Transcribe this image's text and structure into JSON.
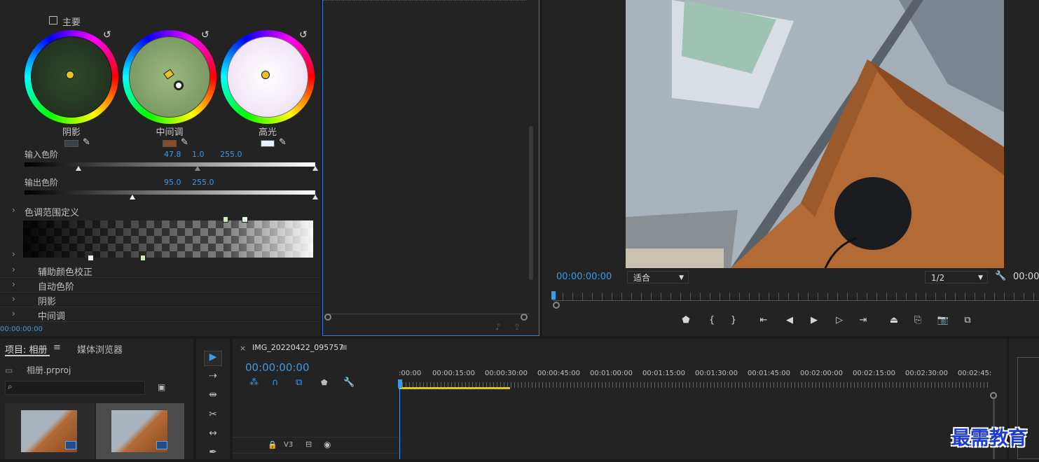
{
  "lumetri": {
    "master_checkbox_label": "主要",
    "wheels": [
      {
        "label": "阴影",
        "swatch_color": "#3b4147"
      },
      {
        "label": "中间调",
        "swatch_color": "#8a4c25"
      },
      {
        "label": "高光",
        "swatch_color": "#e8efff"
      }
    ],
    "input_levels": {
      "label": "输入色阶",
      "low": "47.8",
      "mid": "1.0",
      "high": "255.0"
    },
    "output_levels": {
      "label": "输出色阶",
      "low": "95.0",
      "high": "255.0"
    },
    "tone_range": {
      "label": "色调范围定义"
    },
    "sections": [
      {
        "label": "辅助颜色校正"
      },
      {
        "label": "自动色阶"
      },
      {
        "label": "阴影"
      },
      {
        "label": "中间调"
      }
    ],
    "timecode": "00:00:00:00"
  },
  "program_monitor": {
    "timecode_left": "00:00:00:00",
    "zoom_select": "适合",
    "resolution_select": "1/2",
    "timecode_right": "00:00",
    "controls": [
      {
        "name": "add-marker-button",
        "glyph": "⬟"
      },
      {
        "name": "mark-in-button",
        "glyph": "{"
      },
      {
        "name": "mark-out-button",
        "glyph": "}"
      },
      {
        "name": "go-to-in-button",
        "glyph": "⇤"
      },
      {
        "name": "step-back-button",
        "glyph": "◀"
      },
      {
        "name": "play-button",
        "glyph": "▶"
      },
      {
        "name": "step-forward-button",
        "glyph": "▷"
      },
      {
        "name": "go-to-out-button",
        "glyph": "⇥"
      },
      {
        "name": "lift-button",
        "glyph": "⏏"
      },
      {
        "name": "extract-button",
        "glyph": "⎘"
      },
      {
        "name": "export-frame-button",
        "glyph": "📷"
      },
      {
        "name": "comparison-view-button",
        "glyph": "⧉"
      }
    ]
  },
  "project": {
    "tab_label": "项目: 相册",
    "media_browser_label": "媒体浏览器",
    "file_name": "相册.prproj",
    "search_placeholder": ""
  },
  "timeline": {
    "sequence_name": "IMG_20220422_095757",
    "timecode": "00:00:00:00",
    "ruler_labels": [
      ":00:00",
      "00:00:15:00",
      "00:00:30:00",
      "00:00:45:00",
      "00:01:00:00",
      "00:01:15:00",
      "00:01:30:00",
      "00:01:45:00",
      "00:02:00:00",
      "00:02:15:00",
      "00:02:30:00",
      "00:02:45:"
    ],
    "track_v3": "V3"
  },
  "watermark": "最需教育",
  "colors": {
    "accent": "#3a9be8",
    "panel": "#232323",
    "work_area": "#d8c81e"
  }
}
